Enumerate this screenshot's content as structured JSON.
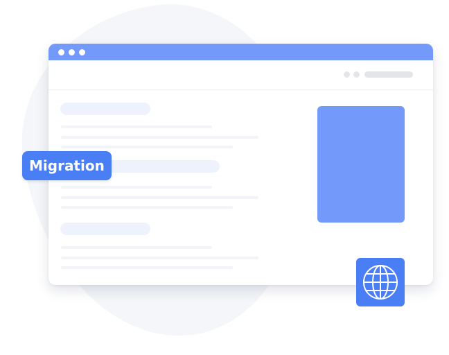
{
  "illustration": {
    "window": {
      "titlebar_color": "#7399fb",
      "titlebar_buttons": 3,
      "toolbar_indicators": 2
    },
    "badge": {
      "label": "Migration",
      "color": "#4a7ef5"
    },
    "globe_tile": {
      "icon": "globe-icon",
      "color": "#4a7ef5"
    },
    "image_placeholder_color": "#7399fb"
  }
}
